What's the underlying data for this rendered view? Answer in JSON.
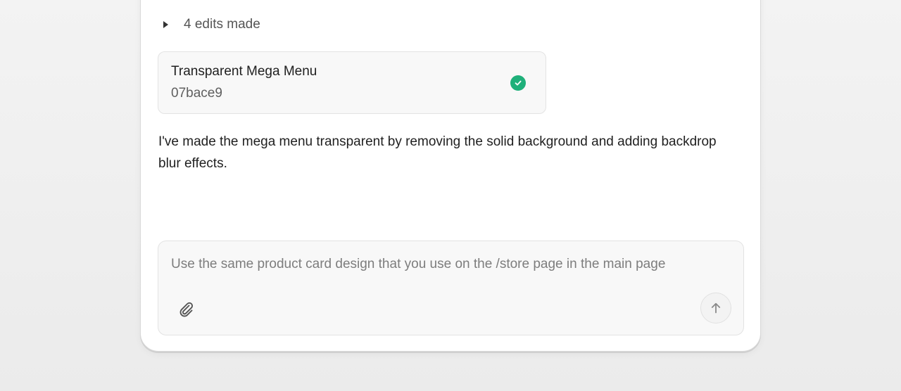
{
  "edits": {
    "label": "4 edits made"
  },
  "commit": {
    "title": "Transparent Mega Menu",
    "hash": "07bace9",
    "status_icon": "check-circle-icon",
    "status_color": "#1fb07a"
  },
  "assistant_message": {
    "text": "I've made the mega menu transparent by removing the solid background and adding backdrop blur effects."
  },
  "composer": {
    "value": "",
    "placeholder": "Use the same product card design that you use on the /store page in the main page",
    "attach_icon": "paperclip-icon",
    "send_icon": "arrow-up-icon"
  }
}
